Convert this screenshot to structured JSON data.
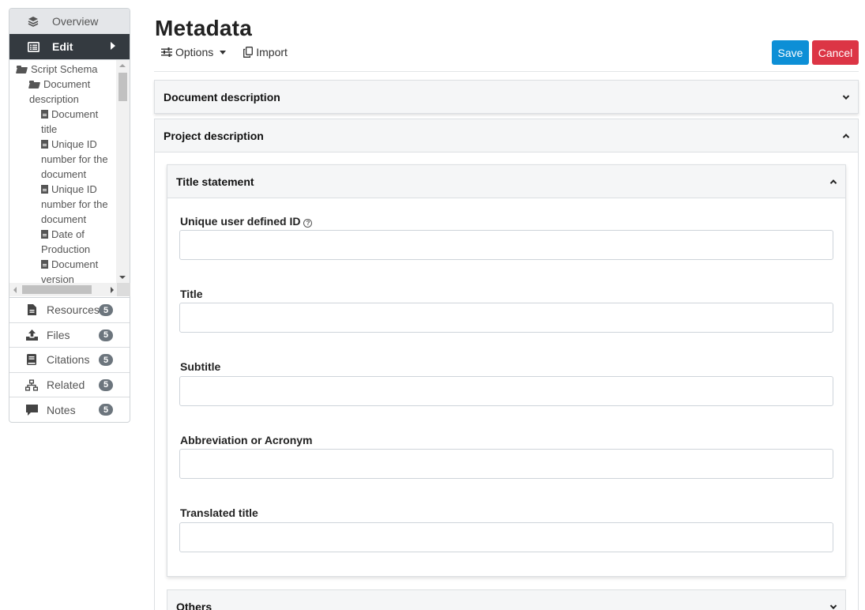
{
  "sidebar": {
    "overview_label": "Overview",
    "edit_label": "Edit",
    "tree": [
      {
        "label": "Script Schema",
        "type": "folder",
        "level": 0
      },
      {
        "label": "Document description",
        "type": "folder",
        "level": 1
      },
      {
        "label": "Document title",
        "type": "file",
        "level": 2
      },
      {
        "label": "Unique ID number for the document",
        "type": "file",
        "level": 2
      },
      {
        "label": "Unique ID number for the document",
        "type": "file",
        "level": 2
      },
      {
        "label": "Date of Production",
        "type": "file",
        "level": 2
      },
      {
        "label": "Document version",
        "type": "file",
        "level": 2
      }
    ],
    "items": [
      {
        "label": "Resources",
        "count": "5",
        "icon": "file-icon"
      },
      {
        "label": "Files",
        "count": "5",
        "icon": "upload-icon"
      },
      {
        "label": "Citations",
        "count": "5",
        "icon": "book-icon"
      },
      {
        "label": "Related",
        "count": "5",
        "icon": "sitemap-icon"
      },
      {
        "label": "Notes",
        "count": "5",
        "icon": "comment-icon"
      }
    ]
  },
  "main": {
    "title": "Metadata",
    "toolbar": {
      "options_label": "Options",
      "import_label": "Import"
    },
    "buttons": {
      "save": "Save",
      "cancel": "Cancel"
    },
    "sections": {
      "document_description": "Document description",
      "project_description": "Project description",
      "title_statement": "Title statement",
      "others": "Others"
    },
    "fields": {
      "unique_id": {
        "label": "Unique user defined ID",
        "value": ""
      },
      "title": {
        "label": "Title",
        "value": ""
      },
      "subtitle": {
        "label": "Subtitle",
        "value": ""
      },
      "abbreviation": {
        "label": "Abbreviation or Acronym",
        "value": ""
      },
      "translated_title": {
        "label": "Translated title",
        "value": ""
      }
    },
    "help_glyph": "?"
  },
  "colors": {
    "edit_bg": "#343a40",
    "save": "#0d8fd6",
    "cancel": "#dc3545",
    "badge": "#6c757d"
  }
}
